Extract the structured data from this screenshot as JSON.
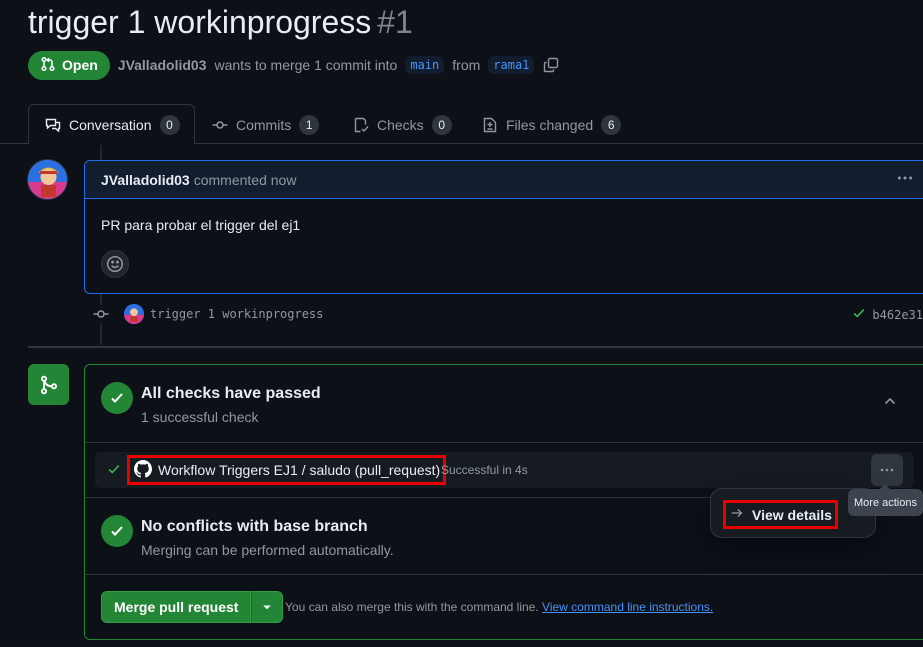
{
  "pr": {
    "title": "trigger 1 workinprogress",
    "number": "#1",
    "state": "Open",
    "author": "JValladolid03",
    "merge_text": "wants to merge 1 commit into",
    "base_branch": "main",
    "from_text": "from",
    "head_branch": "rama1"
  },
  "tabs": [
    {
      "label": "Conversation",
      "count": "0",
      "icon": "comment-discussion-icon"
    },
    {
      "label": "Commits",
      "count": "1",
      "icon": "git-commit-icon"
    },
    {
      "label": "Checks",
      "count": "0",
      "icon": "checklist-icon"
    },
    {
      "label": "Files changed",
      "count": "6",
      "icon": "file-diff-icon"
    }
  ],
  "comment": {
    "author": "JValladolid03",
    "action": "commented now",
    "body": "PR para probar el trigger del ej1",
    "more_icon": "kebab-horizontal-icon"
  },
  "commit": {
    "message": "trigger 1 workinprogress",
    "sha": "b462e31"
  },
  "checks": {
    "title": "All checks have passed",
    "subtitle": "1 successful check",
    "items": [
      {
        "name": "Workflow Triggers EJ1 / saludo (pull_request)",
        "status": "Successful in 4s"
      }
    ]
  },
  "conflicts": {
    "title": "No conflicts with base branch",
    "subtitle": "Merging can be performed automatically."
  },
  "merge": {
    "button_label": "Merge pull request",
    "hint": "You can also merge this with the command line.",
    "link": "View command line instructions."
  },
  "menu": {
    "view_details": "View details",
    "tooltip": "More actions"
  },
  "colors": {
    "success": "#238636",
    "accent": "#1f6feb",
    "highlight": "#e60000",
    "background": "#0d1117"
  }
}
